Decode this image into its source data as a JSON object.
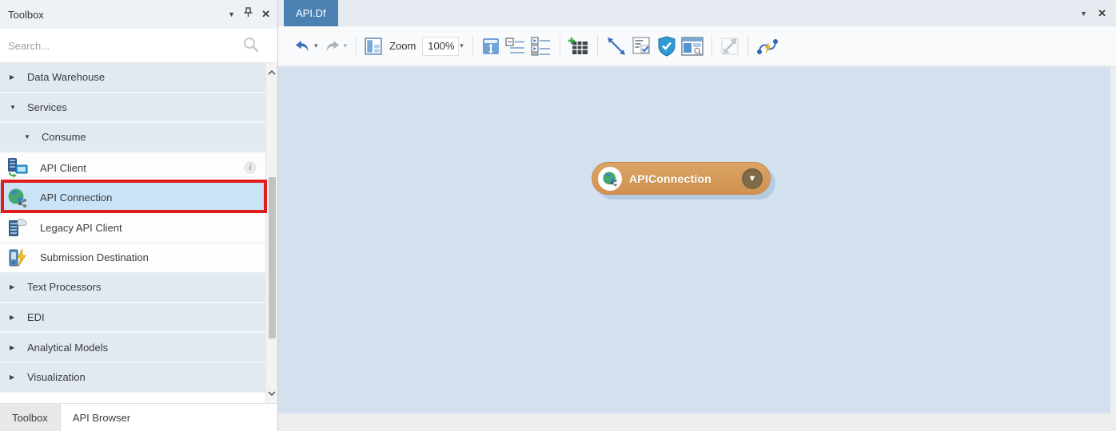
{
  "toolbox": {
    "title": "Toolbox",
    "search": {
      "placeholder": "Search..."
    },
    "rows": [
      {
        "label": "Data Warehouse",
        "type": "category",
        "level": 1,
        "state": "collapsed"
      },
      {
        "label": "Services",
        "type": "category",
        "level": 1,
        "state": "expanded"
      },
      {
        "label": "Consume",
        "type": "category",
        "level": 2,
        "state": "expanded"
      },
      {
        "label": "API Client",
        "type": "item",
        "icon": "api-client-icon",
        "has_info": true
      },
      {
        "label": "API Connection",
        "type": "item",
        "icon": "api-connection-icon",
        "selected": true,
        "annotated": true
      },
      {
        "label": "Legacy API Client",
        "type": "item",
        "icon": "legacy-api-client-icon"
      },
      {
        "label": "Submission Destination",
        "type": "item",
        "icon": "submission-destination-icon"
      },
      {
        "label": "Text Processors",
        "type": "category",
        "level": 1,
        "state": "collapsed"
      },
      {
        "label": "EDI",
        "type": "category",
        "level": 1,
        "state": "collapsed"
      },
      {
        "label": "Analytical Models",
        "type": "category",
        "level": 1,
        "state": "collapsed"
      },
      {
        "label": "Visualization",
        "type": "category",
        "level": 1,
        "state": "collapsed"
      }
    ],
    "bottom_tabs": [
      {
        "label": "Toolbox",
        "active": true
      },
      {
        "label": "API Browser",
        "active": false
      }
    ]
  },
  "designer": {
    "document_tab": {
      "label": "API.Df",
      "active": true
    },
    "toolbar": {
      "zoom_label": "Zoom",
      "zoom_value": "100%",
      "icon_names": [
        "undo",
        "redo",
        "layout-preview",
        "fit-height",
        "collapse-all",
        "expand-all",
        "insert-table",
        "draw-connector",
        "validate-schedule",
        "security-check",
        "preview-window",
        "resize",
        "reroute-connector"
      ]
    },
    "canvas": {
      "node": {
        "label": "APIConnection"
      }
    }
  },
  "icons": {
    "chevron_right": "▶",
    "chevron_down": "▼",
    "header_dropdown": "▼",
    "close": "✕",
    "info": "i",
    "toolbar_caret": "▾",
    "node_dropdown": "▼"
  },
  "annotation": {
    "highlight_box_color": "#e11c1c"
  },
  "colors": {
    "selected_row": "#cbe3f7",
    "category_row": "#e1e9f1",
    "canvas": "#d3e1ef",
    "document_tab": "#4b80b2",
    "node_fill": "#d0924f",
    "node_shadow": "#aac4dd"
  }
}
